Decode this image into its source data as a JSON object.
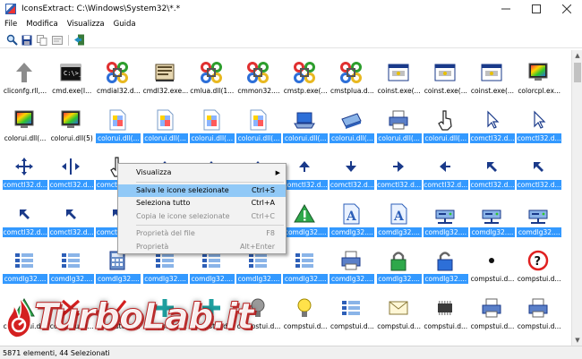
{
  "window": {
    "title": "IconsExtract:  C:\\Windows\\System32\\*.*",
    "controls": [
      "minimize-icon",
      "maximize-icon",
      "close-icon"
    ]
  },
  "menubar": {
    "items": [
      "File",
      "Modifica",
      "Visualizza",
      "Guida"
    ]
  },
  "toolbar": {
    "buttons": [
      "search-icon",
      "save-icon",
      "copy-icon",
      "properties-icon",
      "exit-icon"
    ]
  },
  "icons": {
    "rows": [
      [
        {
          "label": "cliconfg.rll,...",
          "icon": "up-arrow-icon",
          "selected": false
        },
        {
          "label": "cmd.exe(I...",
          "icon": "console-icon",
          "selected": false
        },
        {
          "label": "cmdial32.d...",
          "icon": "cmd-key-icon",
          "selected": false
        },
        {
          "label": "cmdl32.exe...",
          "icon": "phonebook-icon",
          "selected": false
        },
        {
          "label": "cmlua.dll(1...",
          "icon": "cmd-key-icon",
          "selected": false
        },
        {
          "label": "cmmon32....",
          "icon": "cmd-key-icon",
          "selected": false
        },
        {
          "label": "cmstp.exe(...",
          "icon": "cmd-key-icon",
          "selected": false
        },
        {
          "label": "cmstplua.d...",
          "icon": "cmd-key-icon",
          "selected": false
        },
        {
          "label": "coinst.exe(...",
          "icon": "window-app-icon",
          "selected": false
        },
        {
          "label": "coinst.exe(...",
          "icon": "window-app-icon",
          "selected": false
        },
        {
          "label": "coinst.exe(...",
          "icon": "window-app-icon",
          "selected": false
        },
        {
          "label": "colorcpl.ex...",
          "icon": "color-monitor-icon",
          "selected": false
        }
      ],
      [
        {
          "label": "colorui.dll(...",
          "icon": "color-monitor-icon",
          "selected": false
        },
        {
          "label": "colorui.dll(5)",
          "icon": "color-monitor-icon",
          "selected": false
        },
        {
          "label": "colorui.dll(...",
          "icon": "color-page-icon",
          "selected": true
        },
        {
          "label": "colorui.dll(...",
          "icon": "color-page-icon",
          "selected": true
        },
        {
          "label": "colorui.dll(...",
          "icon": "color-page-icon",
          "selected": true
        },
        {
          "label": "colorui.dll(...",
          "icon": "color-page-icon",
          "selected": true
        },
        {
          "label": "colorui.dll(...",
          "icon": "laptop-icon",
          "selected": true
        },
        {
          "label": "colorui.dll(...",
          "icon": "scanner-icon",
          "selected": true
        },
        {
          "label": "colorui.dll(...",
          "icon": "printer-icon",
          "selected": true
        },
        {
          "label": "colorui.dll(...",
          "icon": "hand-pointer-icon",
          "selected": true
        },
        {
          "label": "comctl32.d...",
          "icon": "cursor-icon",
          "selected": true
        },
        {
          "label": "comctl32.d...",
          "icon": "cursor-icon",
          "selected": true
        }
      ],
      [
        {
          "label": "comctl32.d...",
          "icon": "move-arrows-icon",
          "selected": true
        },
        {
          "label": "comctl32.d...",
          "icon": "split-horizontal-icon",
          "selected": true
        },
        {
          "label": "comctl32.d...",
          "icon": "hand-pointer-icon",
          "selected": true
        },
        {
          "label": "comctl32.d...",
          "icon": "arrow-up-small-icon",
          "selected": true
        },
        {
          "label": "comctl32.d...",
          "icon": "arrow-up-small-icon",
          "selected": true
        },
        {
          "label": "comctl32.d...",
          "icon": "arrow-up-small-icon",
          "selected": true
        },
        {
          "label": "comctl32.d...",
          "icon": "arrow-up-small-icon",
          "selected": true
        },
        {
          "label": "comctl32.d...",
          "icon": "arrow-down-small-icon",
          "selected": true
        },
        {
          "label": "comctl32.d...",
          "icon": "arrow-right-small-icon",
          "selected": true
        },
        {
          "label": "comctl32.d...",
          "icon": "arrow-left-small-icon",
          "selected": true
        },
        {
          "label": "comctl32.d...",
          "icon": "arrow-diag-icon",
          "selected": true
        },
        {
          "label": "comctl32.d...",
          "icon": "arrow-diag-icon",
          "selected": true
        }
      ],
      [
        {
          "label": "comctl32.d...",
          "icon": "arrow-diag-icon",
          "selected": true
        },
        {
          "label": "comctl32.d...",
          "icon": "arrow-diag-icon",
          "selected": true
        },
        {
          "label": "comctl32.d...",
          "icon": "arrow-diag-icon",
          "selected": true
        },
        {
          "label": "comctl32.d...",
          "icon": "arrow-diag-icon",
          "selected": true
        },
        {
          "label": "comctl32.d...",
          "icon": "arrow-diag-icon",
          "selected": true
        },
        {
          "label": "comctl32.d...",
          "icon": "arrow-diag-icon",
          "selected": true
        },
        {
          "label": "comdlg32....",
          "icon": "warning-icon",
          "selected": true
        },
        {
          "label": "comdlg32....",
          "icon": "font-a-icon",
          "selected": true
        },
        {
          "label": "comdlg32....",
          "icon": "font-a-icon",
          "selected": true
        },
        {
          "label": "comdlg32....",
          "icon": "network-drive-icon",
          "selected": true
        },
        {
          "label": "comdlg32....",
          "icon": "network-drive-icon",
          "selected": true
        },
        {
          "label": "comdlg32....",
          "icon": "network-drive-icon",
          "selected": true
        }
      ],
      [
        {
          "label": "comdlg32....",
          "icon": "list-view-icon",
          "selected": true
        },
        {
          "label": "comdlg32....",
          "icon": "list-view-icon",
          "selected": true
        },
        {
          "label": "comdlg32....",
          "icon": "calculator-icon",
          "selected": true
        },
        {
          "label": "comdlg32....",
          "icon": "list-view-icon",
          "selected": true
        },
        {
          "label": "comdlg32....",
          "icon": "list-view-icon",
          "selected": true
        },
        {
          "label": "comdlg32....",
          "icon": "list-view-icon",
          "selected": true
        },
        {
          "label": "comdlg32....",
          "icon": "list-view-icon",
          "selected": true
        },
        {
          "label": "comdlg32....",
          "icon": "printer-icon",
          "selected": true
        },
        {
          "label": "comdlg32....",
          "icon": "lock-icon",
          "selected": true
        },
        {
          "label": "comdlg32....",
          "icon": "unlock-icon",
          "selected": true
        },
        {
          "label": "compstui.d...",
          "icon": "dot-icon",
          "selected": false
        },
        {
          "label": "compstui.d...",
          "icon": "help-icon",
          "selected": false
        }
      ],
      [
        {
          "label": "compstui.d...",
          "icon": "warning-icon",
          "selected": false
        },
        {
          "label": "compstui.d...",
          "icon": "red-x-icon",
          "selected": false
        },
        {
          "label": "compstui.d...",
          "icon": "red-check-icon",
          "selected": false
        },
        {
          "label": "compstui.d...",
          "icon": "plus-icon",
          "selected": false
        },
        {
          "label": "compstui.d...",
          "icon": "plus-icon",
          "selected": false
        },
        {
          "label": "compstui.d...",
          "icon": "bulb-off-icon",
          "selected": false
        },
        {
          "label": "compstui.d...",
          "icon": "bulb-on-icon",
          "selected": false
        },
        {
          "label": "compstui.d...",
          "icon": "list-view-icon",
          "selected": false
        },
        {
          "label": "compstui.d...",
          "icon": "envelope-icon",
          "selected": false
        },
        {
          "label": "compstui.d...",
          "icon": "chip-icon",
          "selected": false
        },
        {
          "label": "compstui.d...",
          "icon": "printer-icon",
          "selected": false
        },
        {
          "label": "compstui.d...",
          "icon": "printer-icon",
          "selected": false
        }
      ]
    ]
  },
  "context_menu": {
    "items": [
      {
        "label": "Visualizza",
        "shortcut": "",
        "submenu": true,
        "disabled": false,
        "highlight": false
      },
      {
        "label": "Salva le icone selezionate",
        "shortcut": "Ctrl+S",
        "submenu": false,
        "disabled": false,
        "highlight": true
      },
      {
        "label": "Seleziona tutto",
        "shortcut": "Ctrl+A",
        "submenu": false,
        "disabled": false,
        "highlight": false
      },
      {
        "label": "Copia le icone selezionate",
        "shortcut": "Ctrl+C",
        "submenu": false,
        "disabled": true,
        "highlight": false
      },
      {
        "label": "Proprietà del file",
        "shortcut": "F8",
        "submenu": false,
        "disabled": true,
        "highlight": false
      },
      {
        "label": "Proprietà",
        "shortcut": "Alt+Enter",
        "submenu": false,
        "disabled": true,
        "highlight": false
      }
    ]
  },
  "watermark": {
    "brand": "TurboLab.it"
  },
  "statusbar": {
    "text": "5871 elementi, 44 Selezionati"
  },
  "colors": {
    "selection": "#3399ff",
    "menu_highlight": "#91c9f7",
    "watermark_red": "#b22222"
  }
}
